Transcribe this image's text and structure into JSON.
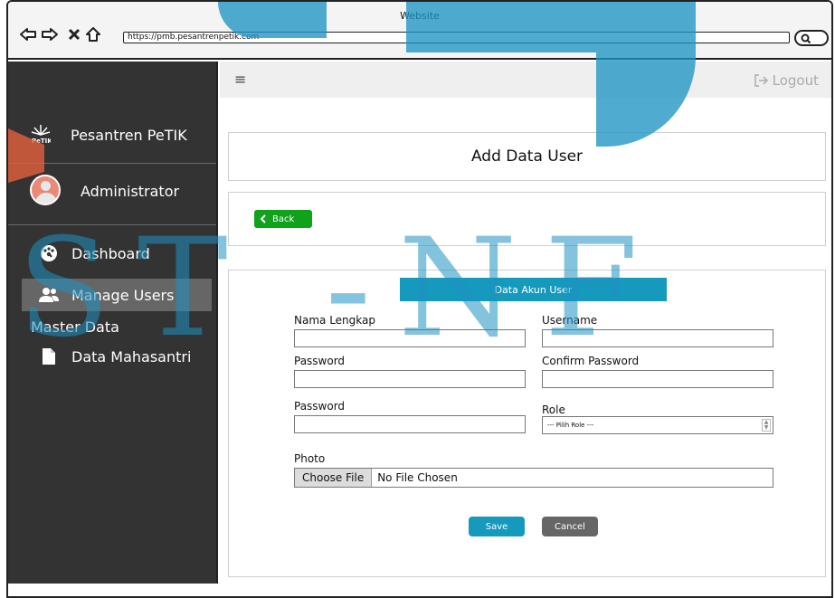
{
  "browser": {
    "title": "Website",
    "url": "https://pmb.pesantrenpetik.com"
  },
  "sidebar": {
    "brand_name": "Pesantren PeTIK",
    "logo_text": "PeTIK",
    "user_name": "Administrator",
    "items": [
      {
        "label": "Dashboard",
        "icon": "dashboard-icon",
        "active": false
      },
      {
        "label": "Manage Users",
        "icon": "users-icon",
        "active": true
      }
    ],
    "section_label": "Master Data",
    "sub_items": [
      {
        "label": "Data Mahasantri",
        "icon": "document-icon"
      }
    ]
  },
  "header": {
    "logout_label": "Logout"
  },
  "page": {
    "title": "Add Data User",
    "back_label": "Back"
  },
  "form": {
    "section_title": "Data Akun User",
    "fields": {
      "nama_lengkap": {
        "label": "Nama Lengkap",
        "value": ""
      },
      "username": {
        "label": "Username",
        "value": ""
      },
      "password": {
        "label": "Password",
        "value": ""
      },
      "confirm_password": {
        "label": "Confirm Password",
        "value": ""
      },
      "password2": {
        "label": "Password",
        "value": ""
      },
      "role": {
        "label": "Role",
        "selected": "--- Pilih Role ---"
      },
      "photo": {
        "label": "Photo",
        "button_label": "Choose File",
        "status": "No File Chosen"
      }
    },
    "save_label": "Save",
    "cancel_label": "Cancel"
  },
  "watermark": {
    "text": "ST -NF"
  },
  "colors": {
    "sidebar_bg": "#333333",
    "sidebar_active": "#666666",
    "primary": "#1599bd",
    "back_button": "#11a21c",
    "cancel_button": "#666666",
    "watermark": "#1f93c4"
  }
}
